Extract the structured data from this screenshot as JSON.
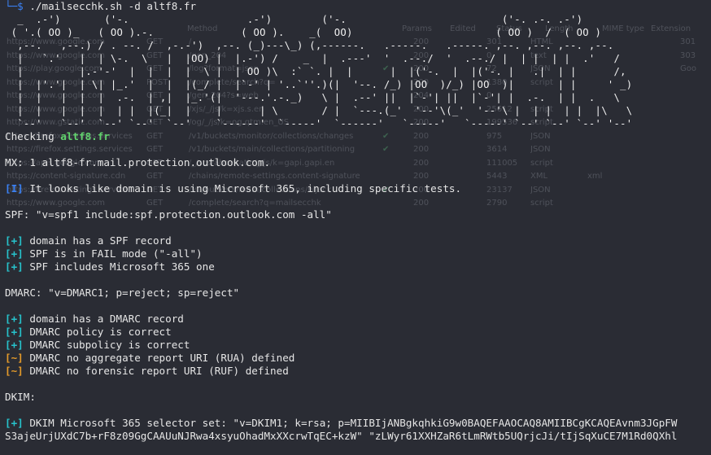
{
  "prompt": {
    "fragment": "└─$",
    "command": "./mailsecchk.sh -d altf8.fr"
  },
  "banner": [
    "  _  .-')       ('-.                   .-')        ('-.                         ('-. .-. .-')",
    " ( '.( OO )_   ( OO ).-.              ( OO ).    _(  OO)                       ( OO )  /  ( OO )",
    "  ,--.   ,--.) / . --. /  ,-.-')  ,--. (_)---\\_) (,------.   .-----.   .-----. ,--. ,--. ,--. ,--.",
    "  |   `.'   |  | \\-.  \\   |  |OO) |  |.-') /    _  |  .---'  '  .--./  '  .--./ |  | |  | |  .'   /",
    "  |         |.-'-'  |  |  |  |  \\ |  | OO )\\  :` `. |  |      |  |('-.  |  |('-. |   .|  | |      /,",
    "  |  |'.'|  | \\| |_.'  |  |  |(_/ |  |`-' | '..`''.)(|  '--. /_) |OO  )/_) |OO  )|       | |     ' _)",
    "  |  |   |  |  |  .-.  | ,|  |_.'(|  '---.'.-._)   \\ |  .--' ||  |`-'| ||  |`-'| |  .-.  | |  .   \\",
    "  |  |   |  |  |  | |  |(_|  |    |      | \\       / |  `---.(_'  '--'\\(_'  '--'\\ |  | |  | |  |\\   \\",
    "  `--'   `--'  `--' `--'  `--'    `------'  `-----'  `------'   `-----'   `-----' `--' `--' `--' '--'"
  ],
  "checking": {
    "label": "Checking ",
    "domain": "altf8.fr"
  },
  "mx": "MX: 1 altf8-fr.mail.protection.outlook.com.",
  "info_ms365": {
    "tag": "[I]",
    "text": " It looks like domain is using Microsoft 365, including specific tests."
  },
  "spf": {
    "record": "SPF: \"v=spf1 include:spf.protection.outlook.com -all\"",
    "checks": [
      {
        "tag": "[+]",
        "text": " domain has a SPF record"
      },
      {
        "tag": "[+]",
        "text": " SPF is in FAIL mode (\"-all\")"
      },
      {
        "tag": "[+]",
        "text": " SPF includes Microsoft 365 one"
      }
    ]
  },
  "dmarc": {
    "record": "DMARC: \"v=DMARC1; p=reject; sp=reject\"",
    "checks": [
      {
        "tag": "[+]",
        "text": " domain has a DMARC record"
      },
      {
        "tag": "[+]",
        "text": " DMARC policy is correct"
      },
      {
        "tag": "[+]",
        "text": " DMARC subpolicy is correct"
      }
    ],
    "warnings": [
      {
        "tag": "[~]",
        "text": " DMARC no aggregate report URI (RUA) defined"
      },
      {
        "tag": "[~]",
        "text": " DMARC no forensic report URI (RUF) defined"
      }
    ]
  },
  "dkim": {
    "heading": "DKIM:",
    "check": {
      "tag": "[+]",
      "text": " DKIM Microsoft 365 selector set: \"v=DKIM1; k=rsa; p=MIIBIjANBgkqhkiG9w0BAQEFAAOCAQ8AMIIBCgKCAQEAvnm3JGpFW"
    },
    "continuation": "S3ajeUrjUXdC7b+rF8z09GgCAAUuNJRwa4xsyuOhadMxXXcrwTqEC+kzW\" \"zLWyr61XXHZaR6tLmRWtb5UQrjcJi/tIjSqXuCE7M1Rd0QXhl"
  },
  "ghost_table": {
    "headers": [
      "Method",
      "Params",
      "Edited",
      "Status",
      "Length",
      "MIME type",
      "Extension"
    ],
    "rows": [
      [
        "https://www.google.com",
        "GET",
        "/",
        "",
        "200",
        "301",
        "HTML",
        "",
        "301"
      ],
      [
        "https://www.google.com",
        "GET",
        "/gen_204",
        "",
        "200",
        "0",
        "text",
        "",
        "303"
      ],
      [
        "https://play.google.com",
        "GET",
        "/log?format=json",
        "✔",
        "200",
        "72",
        "JSON",
        "",
        "Goo"
      ],
      [
        "https://www.google.com",
        "POST",
        "/complete/search?q=",
        "",
        "200",
        "1380",
        "script",
        "",
        ""
      ],
      [
        "https://www.google.com",
        "GET",
        "/gen_204?s=web",
        "",
        "204",
        "0",
        "",
        "",
        ""
      ],
      [
        "https://www.google.com",
        "GET",
        "/xjs/_/js/k=xjs.s.en",
        "",
        "200",
        "25612",
        "script",
        "",
        ""
      ],
      [
        "https://www.gstatic.com",
        "GET",
        "/og/_/js/k=og.qtm.en_US",
        "",
        "200",
        "199536",
        "script",
        "",
        ""
      ],
      [
        "https://firefox.settings.services",
        "GET",
        "/v1/buckets/monitor/collections/changes",
        "✔",
        "200",
        "975",
        "JSON",
        "",
        ""
      ],
      [
        "https://firefox.settings.services",
        "GET",
        "/v1/buckets/main/collections/partitioning",
        "✔",
        "200",
        "3614",
        "JSON",
        "",
        ""
      ],
      [
        "https://apis.google.com",
        "GET",
        "/_/scs/abc-static/_/js/k=gapi.gapi.en",
        "",
        "200",
        "111005",
        "script",
        "",
        ""
      ],
      [
        "https://content-signature.cdn",
        "GET",
        "/chains/remote-settings.content-signature",
        "",
        "200",
        "5443",
        "XML",
        "xml",
        ""
      ],
      [
        "https://firefox.settings.services",
        "GET",
        "/v1/buckets/main/collections/hijack",
        "✔",
        "200",
        "23137",
        "JSON",
        "",
        ""
      ],
      [
        "https://www.google.com",
        "GET",
        "/complete/search?q=mailsecchk",
        "",
        "200",
        "2790",
        "script",
        "",
        ""
      ]
    ]
  }
}
